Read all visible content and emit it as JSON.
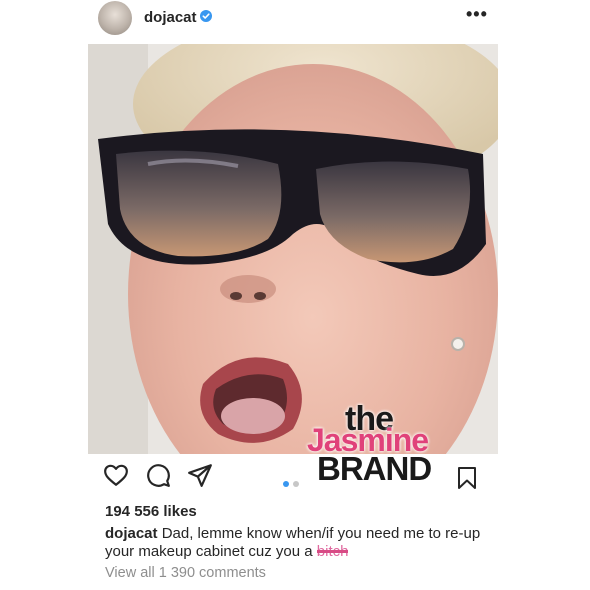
{
  "post": {
    "username": "dojacat",
    "verified": true,
    "more_label": "•••",
    "image_description_icon": "selfie-photo",
    "watermark": {
      "line1": "the",
      "line2": "Jasmine",
      "line3": "BRAND"
    },
    "actions": {
      "like_icon": "heart-icon",
      "comment_icon": "comment-icon",
      "share_icon": "send-icon",
      "save_icon": "bookmark-icon"
    },
    "carousel": {
      "count": 2,
      "active": 1
    },
    "likes": "194 556 likes",
    "caption": {
      "user": "dojacat",
      "text": "Dad, lemme know when/if you need me to re-up your makeup cabinet cuz you a ",
      "censored_word": "bitch"
    },
    "view_comments": "View all 1 390 comments"
  },
  "colors": {
    "verified_blue": "#3897f0",
    "carousel_active": "#3897f0",
    "carousel_inactive": "#c7c7c7",
    "watermark_pink": "#e0427a"
  }
}
